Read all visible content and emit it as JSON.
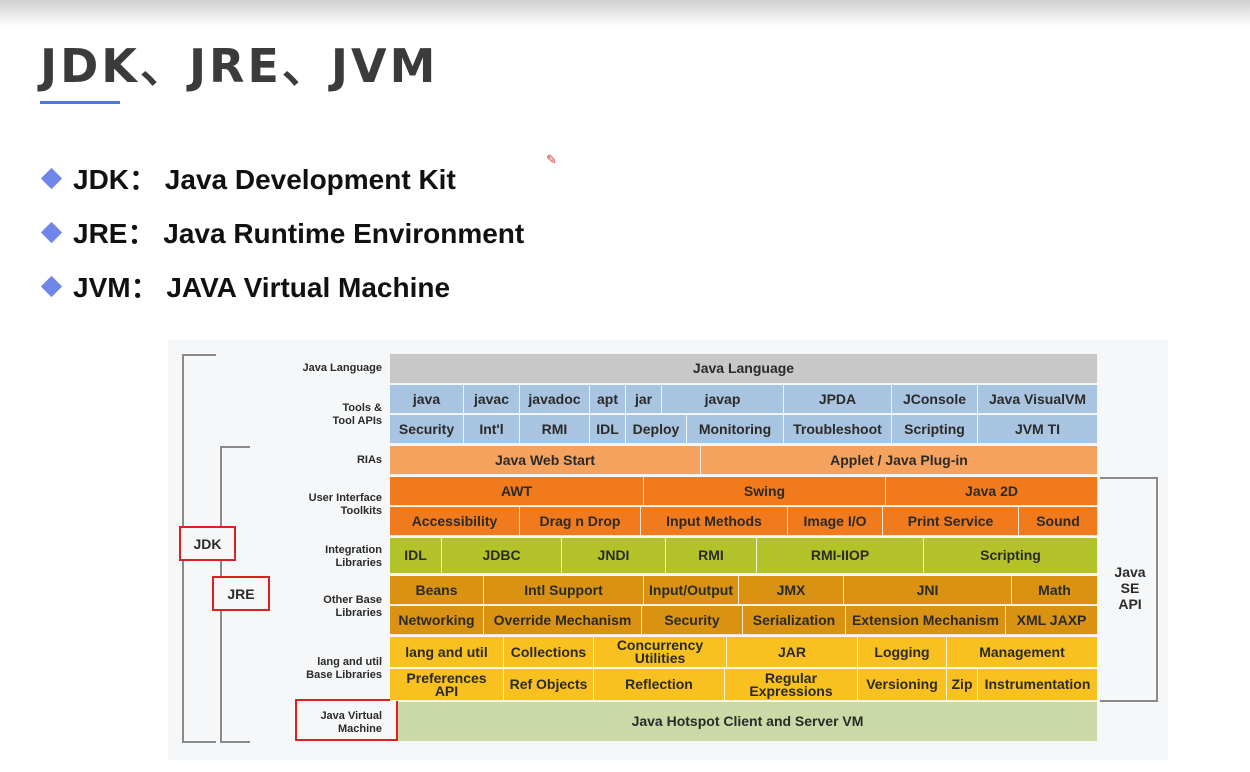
{
  "slide": {
    "title": "JDK、JRE、JVM",
    "bullets": [
      "JDK： Java Development Kit",
      "JRE： Java Runtime Environment",
      "JVM： JAVA Virtual Machine"
    ]
  },
  "diagram": {
    "colors": {
      "gray": "#c8c8c8",
      "blue": "#a9c4e0",
      "light_orange": "#f5a25e",
      "orange": "#f07a1c",
      "olive": "#b4c22a",
      "dark_gold": "#d99212",
      "yellow": "#f9c11f",
      "green": "#cbd9a6"
    },
    "row_labels": {
      "java_language": "Java Language",
      "tools": "Tools &\nTool APIs",
      "rias": "RIAs",
      "ui_toolkits": "User Interface\nToolkits",
      "integration": "Integration\nLibraries",
      "other_base": "Other Base\nLibraries",
      "lang_util": "lang and util\nBase Libraries",
      "jvm": "Java Virtual\nMachine"
    },
    "rows": {
      "java_language": [
        "Java Language"
      ],
      "tools_1": [
        "java",
        "javac",
        "javadoc",
        "apt",
        "jar",
        "javap",
        "JPDA",
        "JConsole",
        "Java VisualVM"
      ],
      "tools_2": [
        "Security",
        "Int'l",
        "RMI",
        "IDL",
        "Deploy",
        "Monitoring",
        "Troubleshoot",
        "Scripting",
        "JVM TI"
      ],
      "rias": [
        "Java Web Start",
        "Applet / Java Plug-in"
      ],
      "ui_1": [
        "AWT",
        "Swing",
        "Java 2D"
      ],
      "ui_2": [
        "Accessibility",
        "Drag n Drop",
        "Input Methods",
        "Image I/O",
        "Print Service",
        "Sound"
      ],
      "integration": [
        "IDL",
        "JDBC",
        "JNDI",
        "RMI",
        "RMI-IIOP",
        "Scripting"
      ],
      "other_1": [
        "Beans",
        "Intl Support",
        "Input/Output",
        "JMX",
        "JNI",
        "Math"
      ],
      "other_2": [
        "Networking",
        "Override Mechanism",
        "Security",
        "Serialization",
        "Extension Mechanism",
        "XML JAXP"
      ],
      "lang_1": [
        "lang and util",
        "Collections",
        "Concurrency\nUtilities",
        "JAR",
        "Logging",
        "Management"
      ],
      "lang_2": [
        "Preferences\nAPI",
        "Ref Objects",
        "Reflection",
        "Regular\nExpressions",
        "Versioning",
        "Zip",
        "Instrumentation"
      ],
      "jvm": [
        "Java Hotspot Client and Server VM"
      ]
    },
    "labels": {
      "jdk": "JDK",
      "jre": "JRE",
      "java_se_api": "Java\nSE\nAPI"
    }
  }
}
